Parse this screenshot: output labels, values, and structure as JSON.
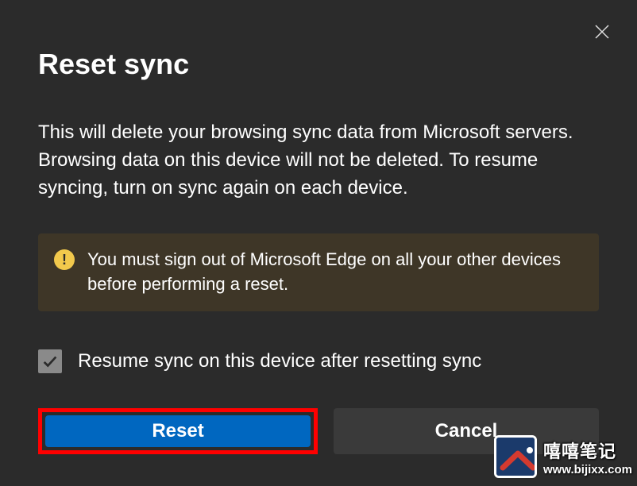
{
  "dialog": {
    "title": "Reset sync",
    "description": "This will delete your browsing sync data from Microsoft servers. Browsing data on this device will not be deleted. To resume syncing, turn on sync again on each device.",
    "info_message": "You must sign out of Microsoft Edge on all your other devices before performing a reset.",
    "checkbox_label": "Resume sync on this device after resetting sync",
    "checkbox_checked": true,
    "primary_button": "Reset",
    "secondary_button": "Cancel"
  },
  "watermark": {
    "line1": "嘻嘻笔记",
    "line2": "www.bijixx.com"
  },
  "colors": {
    "background": "#2b2b2b",
    "info_box_bg": "#3e3627",
    "info_icon_bg": "#f2c94c",
    "primary_button": "#0067c0",
    "secondary_button": "#3a3a3a",
    "highlight_border": "#ff0000"
  }
}
